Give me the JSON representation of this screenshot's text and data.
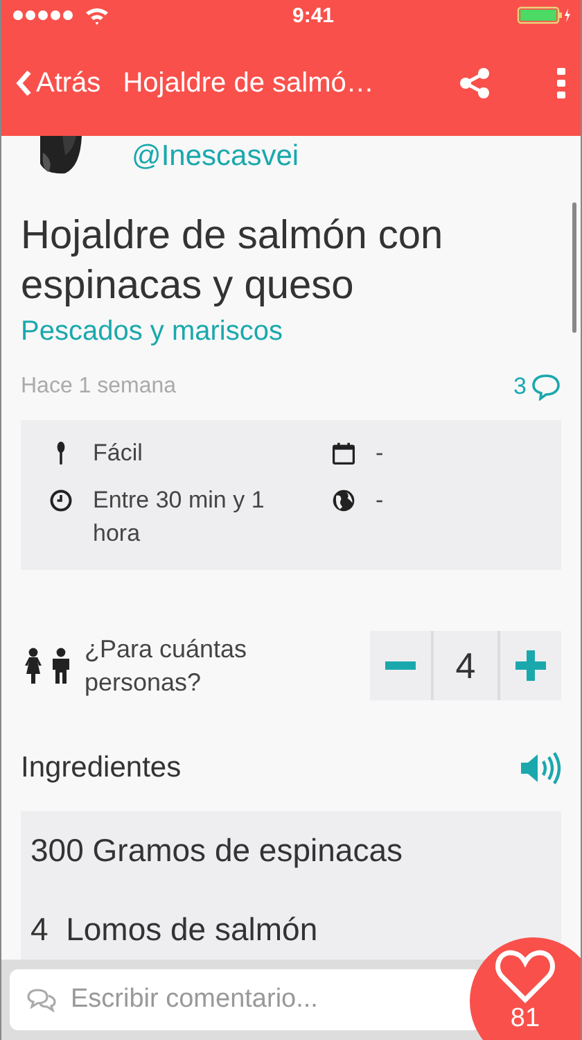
{
  "status_bar": {
    "time": "9:41"
  },
  "nav_bar": {
    "back": "Atrás",
    "title": "Hojaldre de salmó…"
  },
  "author": {
    "handle": "@Inescasvei"
  },
  "recipe": {
    "title": "Hojaldre de salmón con espinacas y queso",
    "category": "Pescados y mariscos",
    "posted": "Hace 1 semana",
    "comments": "3"
  },
  "info": [
    {
      "kind": "difficulty",
      "text": "Fácil"
    },
    {
      "kind": "date",
      "text": "-"
    },
    {
      "kind": "time",
      "text": "Entre 30 min y 1 hora"
    },
    {
      "kind": "origin",
      "text": "-"
    }
  ],
  "servings": {
    "label": "¿Para cuántas personas?",
    "value": "4"
  },
  "ingredients": {
    "heading": "Ingredientes",
    "items": [
      "300 Gramos de espinacas",
      "4  Lomos de salmón"
    ]
  },
  "comment_bar": {
    "placeholder": "Escribir comentario...",
    "likes": "81"
  }
}
